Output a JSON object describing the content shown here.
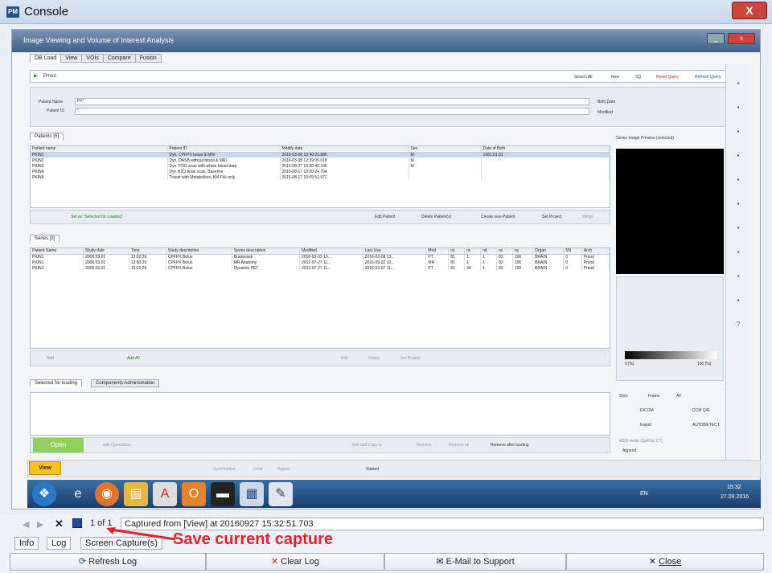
{
  "window": {
    "title": "Console",
    "close_label": "X",
    "app_icon_text": "PM"
  },
  "app": {
    "title": "Image Viewing and Volume of Interest Analysis",
    "tabs": [
      "DB Load",
      "View",
      "VOIs",
      "Compare",
      "Fusion"
    ]
  },
  "db": {
    "source": "Pmod",
    "toolbar": [
      "Search All",
      "New",
      "SQ",
      "Reset Query",
      "Refresh Query"
    ],
    "patient_name_label": "Patient Name",
    "patient_name_value": "PK*",
    "patient_id_label": "Patient ID",
    "patient_id_value": "*",
    "birth_date_label": "Birth Date",
    "modified_label": "Modified"
  },
  "patients": {
    "title": "Patients [5]",
    "columns": [
      "Patient name",
      "Patient ID",
      "Modify date",
      "Sex",
      "Date of Birth"
    ],
    "rows": [
      [
        "PKIN1",
        "Dyn. CPFPX bolus & MRI",
        "2016-03-08 13:40:23.886",
        "M",
        "1981.01.01"
      ],
      [
        "PKIN2",
        "Dyn. DASB without blood & MRI",
        "2016-03-08 12:39:00.018",
        "M",
        ""
      ],
      [
        "PKIN3",
        "Dyn. FDG scan with whole blood data",
        "2016-08-27 16:20:40.106",
        "M",
        ""
      ],
      [
        "PKIN4",
        "Dyn H2O brain scan, Baseline",
        "2016-08-17 10:00:24.704",
        "",
        ""
      ],
      [
        "PKIN5",
        "Tracer with Metabolites, KM File only",
        "2016-08-17 10:05:51.972",
        "",
        ""
      ]
    ],
    "set_loading": "Set as \"Selected for Loading\"",
    "actions": [
      "Edit Patient",
      "Delete Patient(s)",
      "Create new Patient",
      "Set Project",
      "Merge"
    ]
  },
  "series": {
    "title": "Series [3]",
    "columns": [
      "Patient Name",
      "Study date",
      "Time",
      "Study description",
      "Series description",
      "Modified",
      "Last Use",
      "Mod",
      "nz",
      "nv",
      "nd",
      "nx",
      "ny",
      "Organ",
      "SN",
      "Arch"
    ],
    "rows": [
      [
        "PKIN1",
        "2006.03.01",
        "13:02:26",
        "CPFPX Bolus",
        "Brainmask",
        "2016-03-03 13...",
        "2016-03-08 13...",
        "PT",
        "81",
        "1",
        "1",
        "83",
        "106",
        "BRAIN",
        "0",
        "Pmod"
      ],
      [
        "PKIN1",
        "2006.03.01",
        "13:00:20",
        "CPFPX Bolus",
        "MR Anatomy",
        "2012-07-27 11...",
        "2016-09-22 10...",
        "MR",
        "81",
        "1",
        "1",
        "83",
        "106",
        "BRAIN",
        "0",
        "Pmod"
      ],
      [
        "PKIN1",
        "2006.03.01",
        "13:02:26",
        "CPFPX Bolus",
        "Dynamic PET",
        "2012-07-27 11...",
        "2016-03-07 11...",
        "PT",
        "81",
        "34",
        "1",
        "83",
        "106",
        "BRAIN",
        "0",
        "Pmod"
      ]
    ],
    "add": "Add",
    "add_all": "Add All",
    "actions": [
      "Edit",
      "Delete",
      "Set Project"
    ]
  },
  "loading": {
    "tabs": [
      "Selected for loading",
      "Components Administration"
    ],
    "open_label": "Open",
    "with_operations": "with Operations",
    "edit_copy": "Edit and Copy to",
    "remove": "Remove",
    "remove_all": "Remove all",
    "remove_after": "Remove after loading"
  },
  "preview": {
    "label": "Series Image Preview (selected)",
    "range_lo": "0 [%]",
    "range_hi": "100 [%]"
  },
  "right_options": {
    "slice": "Slice",
    "frame": "Frame",
    "all": "All",
    "dicom": "DICOM",
    "dcm_qr": "DCM Q/R",
    "import": "Import",
    "autodetect": "AUTODETECT",
    "append": "Append",
    "vol_mode": "4D(t) mode (Split by CT)"
  },
  "view_bar": {
    "view": "View",
    "synchronize": "Synchronize",
    "color": "Color",
    "report": "Report",
    "started": "Started"
  },
  "taskbar": {
    "lang": "EN",
    "time": "15:32",
    "date": "27.09.2016"
  },
  "capture": {
    "page": "1 of 1",
    "text": "Captured from [View] at 20160927 15:32:51.703"
  },
  "bottom_tabs": [
    "Info",
    "Log",
    "Screen Capture(s)"
  ],
  "annotation": "Save current capture",
  "footer": {
    "refresh": "Refresh Log",
    "clear": "Clear Log",
    "email": "E-Mail to Support",
    "close": "Close"
  },
  "colors": {
    "accent": "#3f5f86",
    "annotation": "#e3212b",
    "green": "#8ed15c"
  }
}
